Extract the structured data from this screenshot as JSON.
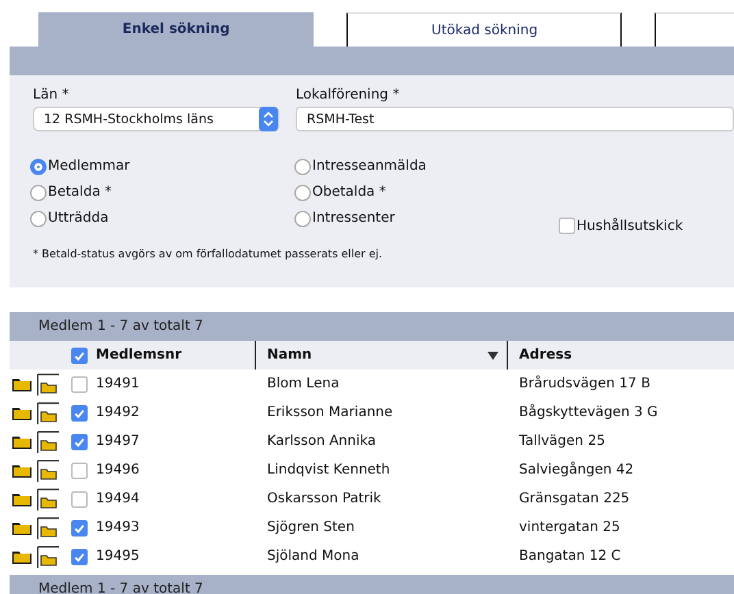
{
  "tabs": [
    {
      "label": "Enkel sökning",
      "selected": true
    },
    {
      "label": "Utökad sökning",
      "selected": false
    }
  ],
  "filters": {
    "lan": {
      "label": "Län",
      "required_mark": "*",
      "value": "12 RSMH-Stockholms läns"
    },
    "lokalforening": {
      "label": "Lokalförening",
      "required_mark": "*",
      "value": "RSMH-Test"
    }
  },
  "radios": [
    {
      "label": "Medlemmar",
      "selected": true
    },
    {
      "label": "Intresseanmälda",
      "selected": false
    },
    {
      "label": "Betalda *",
      "selected": false
    },
    {
      "label": "Obetalda *",
      "selected": false
    },
    {
      "label": "Utträdda",
      "selected": false
    },
    {
      "label": "Intressenter",
      "selected": false
    }
  ],
  "household": {
    "label": "Hushållsutskick",
    "checked": false
  },
  "footnote": "* Betald-status avgörs av om förfallodatumet passerats eller ej.",
  "table": {
    "summary_top": "Medlem 1 - 7 av totalt 7",
    "select_all": true,
    "columns": [
      "Medlemsnr",
      "Namn",
      "Adress"
    ],
    "rows": [
      {
        "checked": false,
        "number": "19491",
        "name": "Blom Lena",
        "address": "Brårudsvägen 17 B"
      },
      {
        "checked": true,
        "number": "19492",
        "name": "Eriksson Marianne",
        "address": "Bågskyttevägen 3 G"
      },
      {
        "checked": true,
        "number": "19497",
        "name": "Karlsson Annika",
        "address": "Tallvägen 25"
      },
      {
        "checked": false,
        "number": "19496",
        "name": "Lindqvist Kenneth",
        "address": "Salviegången 42"
      },
      {
        "checked": false,
        "number": "19494",
        "name": "Oskarsson Patrik",
        "address": "Gränsgatan 225"
      },
      {
        "checked": true,
        "number": "19493",
        "name": "Sjögren Sten",
        "address": "vintergatan 25"
      },
      {
        "checked": true,
        "number": "19495",
        "name": "Sjöland Mona",
        "address": "Bangatan 12 C"
      }
    ],
    "summary_bottom": "Medlem 1 - 7 av totalt 7"
  }
}
